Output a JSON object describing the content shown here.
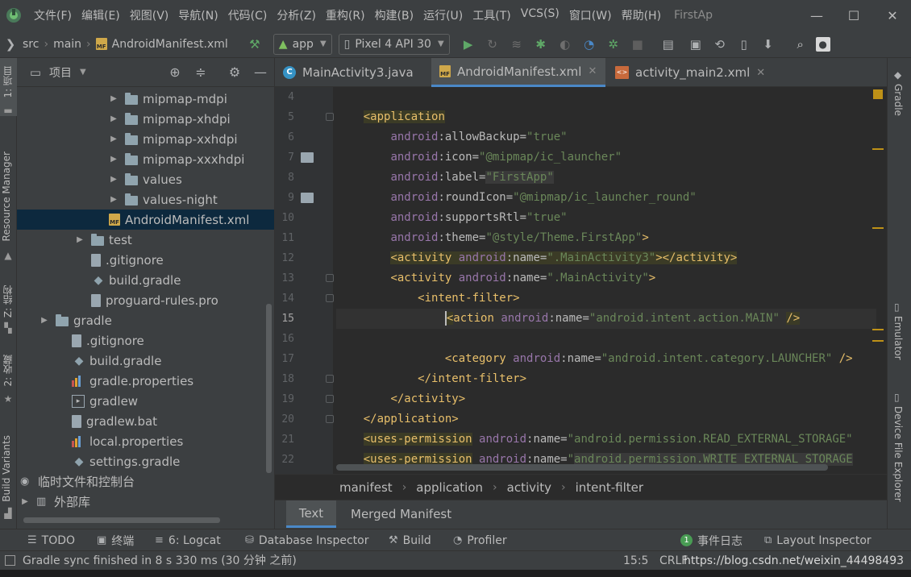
{
  "menu": {
    "items": [
      "文件(F)",
      "编辑(E)",
      "视图(V)",
      "导航(N)",
      "代码(C)",
      "分析(Z)",
      "重构(R)",
      "构建(B)",
      "运行(U)",
      "工具(T)",
      "VCS(S)",
      "窗口(W)",
      "帮助(H)"
    ],
    "project_name": "FirstAp"
  },
  "toolbar": {
    "crumbs": [
      "src",
      "main",
      "AndroidManifest.xml"
    ],
    "run_config": "app",
    "device": "Pixel 4 API 30"
  },
  "left_stripe": {
    "project": "1: 项目",
    "resource_manager": "Resource Manager",
    "structure": "Z: 结构",
    "favorites": "2: 收藏",
    "build_variants": "Build Variants"
  },
  "right_stripe": {
    "gradle": "Gradle",
    "emulator": "Emulator",
    "device_file_explorer": "Device File Explorer"
  },
  "project_panel": {
    "title": "项目",
    "tree": [
      {
        "label": "mipmap-mdpi",
        "type": "folder",
        "indent": 1,
        "arrow": "right"
      },
      {
        "label": "mipmap-xhdpi",
        "type": "folder",
        "indent": 1,
        "arrow": "right"
      },
      {
        "label": "mipmap-xxhdpi",
        "type": "folder",
        "indent": 1,
        "arrow": "right"
      },
      {
        "label": "mipmap-xxxhdpi",
        "type": "folder",
        "indent": 1,
        "arrow": "right"
      },
      {
        "label": "values",
        "type": "folder",
        "indent": 1,
        "arrow": "right"
      },
      {
        "label": "values-night",
        "type": "folder",
        "indent": 1,
        "arrow": "right"
      },
      {
        "label": "AndroidManifest.xml",
        "type": "manifest",
        "indent": 0,
        "arrow": "",
        "selected": true
      },
      {
        "label": "test",
        "type": "folder",
        "indent": -1,
        "arrow": "right"
      },
      {
        "label": ".gitignore",
        "type": "doc",
        "indent": -2,
        "arrow": ""
      },
      {
        "label": "build.gradle",
        "type": "gradle",
        "indent": -2,
        "arrow": ""
      },
      {
        "label": "proguard-rules.pro",
        "type": "doc",
        "indent": -2,
        "arrow": ""
      },
      {
        "label": "gradle",
        "type": "folder",
        "indent": -3,
        "arrow": "right"
      },
      {
        "label": ".gitignore",
        "type": "doc",
        "indent": -4,
        "arrow": ""
      },
      {
        "label": "build.gradle",
        "type": "gradle",
        "indent": -4,
        "arrow": ""
      },
      {
        "label": "gradle.properties",
        "type": "chart",
        "indent": -4,
        "arrow": ""
      },
      {
        "label": "gradlew",
        "type": "term",
        "indent": -4,
        "arrow": ""
      },
      {
        "label": "gradlew.bat",
        "type": "doc",
        "indent": -4,
        "arrow": ""
      },
      {
        "label": "local.properties",
        "type": "chart",
        "indent": -4,
        "arrow": ""
      },
      {
        "label": "settings.gradle",
        "type": "gradle",
        "indent": -4,
        "arrow": ""
      },
      {
        "label": "临时文件和控制台",
        "type": "scratch",
        "indent": -5,
        "arrow": ""
      },
      {
        "label": "外部库",
        "type": "lib",
        "indent": -5,
        "arrow": "right"
      }
    ]
  },
  "editor_tabs": [
    {
      "label": "MainActivity3.java",
      "kind": "java",
      "active": false
    },
    {
      "label": "AndroidManifest.xml",
      "kind": "manifest",
      "active": true
    },
    {
      "label": "activity_main2.xml",
      "kind": "layout",
      "active": false
    }
  ],
  "editor": {
    "current_line": 15,
    "lines": [
      {
        "n": "4",
        "segs": []
      },
      {
        "n": "5",
        "segs": [
          [
            "    ",
            ""
          ],
          [
            "<",
            "tag hl-tag"
          ],
          [
            "application",
            "tag hl-tag"
          ]
        ]
      },
      {
        "n": "6",
        "segs": [
          [
            "        ",
            ""
          ],
          [
            "android",
            "attr-ns"
          ],
          [
            ":allowBackup=",
            "attr"
          ],
          [
            "\"true\"",
            "val"
          ]
        ]
      },
      {
        "n": "7",
        "segs": [
          [
            "        ",
            ""
          ],
          [
            "android",
            "attr-ns"
          ],
          [
            ":icon=",
            "attr"
          ],
          [
            "\"@mipmap/ic_launcher\"",
            "val"
          ]
        ]
      },
      {
        "n": "8",
        "segs": [
          [
            "        ",
            ""
          ],
          [
            "android",
            "attr-ns"
          ],
          [
            ":label=",
            "attr"
          ],
          [
            "\"FirstApp\"",
            "val hl-val"
          ]
        ]
      },
      {
        "n": "9",
        "segs": [
          [
            "        ",
            ""
          ],
          [
            "android",
            "attr-ns"
          ],
          [
            ":roundIcon=",
            "attr"
          ],
          [
            "\"@mipmap/ic_launcher_round\"",
            "val"
          ]
        ]
      },
      {
        "n": "10",
        "segs": [
          [
            "        ",
            ""
          ],
          [
            "android",
            "attr-ns"
          ],
          [
            ":supportsRtl=",
            "attr"
          ],
          [
            "\"true\"",
            "val"
          ]
        ]
      },
      {
        "n": "11",
        "segs": [
          [
            "        ",
            ""
          ],
          [
            "android",
            "attr-ns"
          ],
          [
            ":theme=",
            "attr"
          ],
          [
            "\"@style/Theme.FirstApp\"",
            "val"
          ],
          [
            ">",
            "tag"
          ]
        ]
      },
      {
        "n": "12",
        "segs": [
          [
            "        ",
            ""
          ],
          [
            "<activity ",
            "tag hl-tag"
          ],
          [
            "android",
            "attr-ns hl-tag"
          ],
          [
            ":name=",
            "attr hl-tag"
          ],
          [
            "\".MainActivity3\"",
            "val hl-tag"
          ],
          [
            "></activity>",
            "tag hl-tag"
          ]
        ]
      },
      {
        "n": "13",
        "segs": [
          [
            "        ",
            ""
          ],
          [
            "<activity ",
            "tag"
          ],
          [
            "android",
            "attr-ns"
          ],
          [
            ":name=",
            "attr"
          ],
          [
            "\".MainActivity\"",
            "val"
          ],
          [
            ">",
            "tag"
          ]
        ]
      },
      {
        "n": "14",
        "segs": [
          [
            "            ",
            ""
          ],
          [
            "<intent-filter>",
            "tag"
          ]
        ]
      },
      {
        "n": "15",
        "segs": [
          [
            "                ",
            ""
          ],
          [
            "<",
            "tag hl-tag"
          ],
          [
            "action ",
            "tag"
          ],
          [
            "android",
            "attr-ns"
          ],
          [
            ":name=",
            "attr"
          ],
          [
            "\"android.intent.action.MAIN\"",
            "val"
          ],
          [
            " ",
            ""
          ],
          [
            "/>",
            "tag hl-tag"
          ]
        ]
      },
      {
        "n": "16",
        "segs": []
      },
      {
        "n": "17",
        "segs": [
          [
            "                ",
            ""
          ],
          [
            "<category ",
            "tag"
          ],
          [
            "android",
            "attr-ns"
          ],
          [
            ":name=",
            "attr"
          ],
          [
            "\"android.intent.category.LAUNCHER\"",
            "val"
          ],
          [
            " />",
            "tag"
          ]
        ]
      },
      {
        "n": "18",
        "segs": [
          [
            "            ",
            ""
          ],
          [
            "</intent-filter>",
            "tag"
          ]
        ]
      },
      {
        "n": "19",
        "segs": [
          [
            "        ",
            ""
          ],
          [
            "</activity>",
            "tag"
          ]
        ]
      },
      {
        "n": "20",
        "segs": [
          [
            "    ",
            ""
          ],
          [
            "</application>",
            "tag"
          ]
        ]
      },
      {
        "n": "21",
        "segs": [
          [
            "    ",
            ""
          ],
          [
            "<uses-permission",
            "tag hl-tag"
          ],
          [
            " ",
            ""
          ],
          [
            "android",
            "attr-ns"
          ],
          [
            ":name=",
            "attr"
          ],
          [
            "\"android.permission.READ_EXTERNAL_STORAGE\"",
            "val"
          ]
        ]
      },
      {
        "n": "22",
        "segs": [
          [
            "    ",
            ""
          ],
          [
            "<uses-permission",
            "tag hl-tag"
          ],
          [
            " ",
            ""
          ],
          [
            "android",
            "attr-ns"
          ],
          [
            ":name=",
            "attr"
          ],
          [
            "\"",
            "val"
          ],
          [
            "android.permission.WRITE_EXTERNAL_STORAGE",
            "val hl-val"
          ]
        ]
      }
    ]
  },
  "xml_breadcrumbs": [
    "manifest",
    "application",
    "activity",
    "intent-filter"
  ],
  "bottom_tabs": {
    "text": "Text",
    "merged": "Merged Manifest"
  },
  "tool_windows": {
    "todo": "TODO",
    "terminal": "终端",
    "logcat": "6: Logcat",
    "database": "Database Inspector",
    "build": "Build",
    "profiler": "Profiler",
    "event_log_count": "1",
    "event_log": "事件日志",
    "layout_inspector": "Layout Inspector"
  },
  "status": {
    "message": "Gradle sync finished in 8 s 330 ms (30 分钟 之前)",
    "position": "15:5",
    "line_sep": "CRLF",
    "watermark": "https://blog.csdn.net/weixin_44498493"
  },
  "colors": {
    "accent": "#4a88c7",
    "selection": "#0d293e",
    "warning": "#be9117"
  }
}
